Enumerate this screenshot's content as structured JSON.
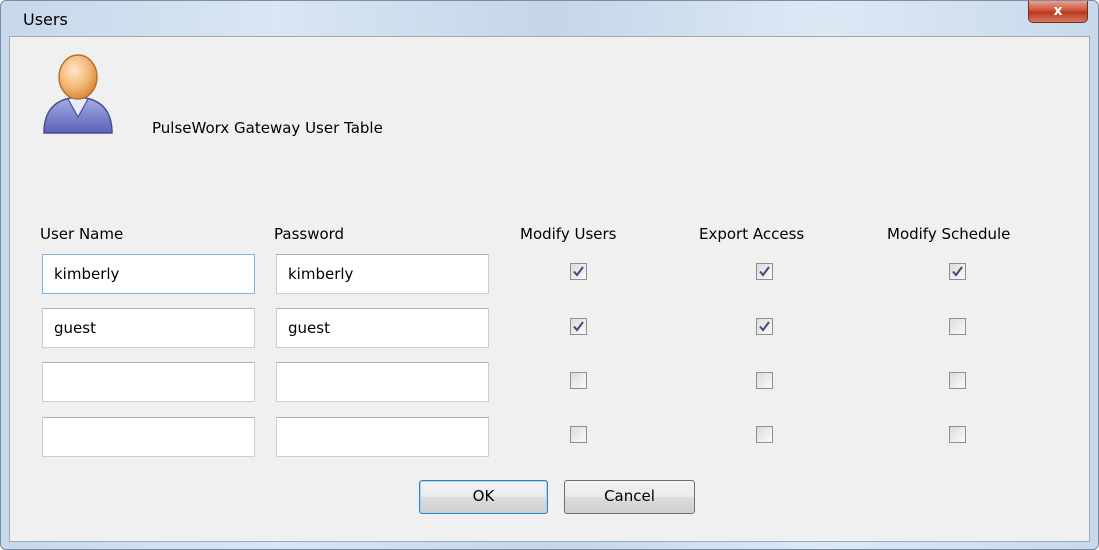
{
  "window": {
    "title": "Users",
    "close_label": "x"
  },
  "header": {
    "title": "PulseWorx Gateway User Table",
    "icon": "user-icon"
  },
  "columns": {
    "user_name": "User Name",
    "password": "Password",
    "modify_users": "Modify Users",
    "export_access": "Export Access",
    "modify_schedule": "Modify Schedule"
  },
  "rows": [
    {
      "user_name": "kimberly",
      "password": "kimberly",
      "modify_users": true,
      "export_access": true,
      "modify_schedule": true
    },
    {
      "user_name": "guest",
      "password": "guest",
      "modify_users": true,
      "export_access": true,
      "modify_schedule": false
    },
    {
      "user_name": "",
      "password": "",
      "modify_users": false,
      "export_access": false,
      "modify_schedule": false
    },
    {
      "user_name": "",
      "password": "",
      "modify_users": false,
      "export_access": false,
      "modify_schedule": false
    }
  ],
  "buttons": {
    "ok": "OK",
    "cancel": "Cancel"
  },
  "colors": {
    "checkmark": "#3c4d7a",
    "focus_border": "#7eb4ea",
    "close_red": "#c94a30"
  }
}
